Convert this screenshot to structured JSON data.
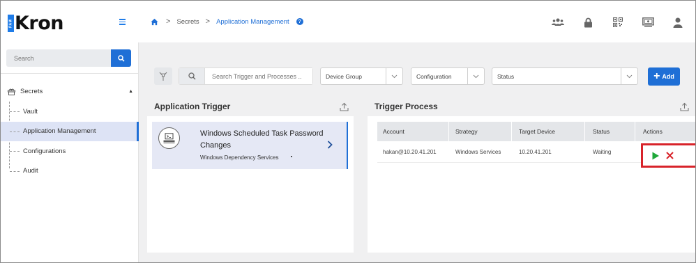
{
  "app": {
    "logo_badge": "PAM",
    "logo_text": "Kron"
  },
  "breadcrumb": {
    "items": [
      "Secrets",
      "Application Management"
    ],
    "separator": ">",
    "help": "?"
  },
  "top_icons": [
    "users-icon",
    "lock-icon",
    "qr-code-icon",
    "monitor-icon",
    "user-icon"
  ],
  "sidebar": {
    "search_placeholder": "Search",
    "group_label": "Secrets",
    "items": [
      {
        "label": "Vault",
        "active": false
      },
      {
        "label": "Application Management",
        "active": true
      },
      {
        "label": "Configurations",
        "active": false
      },
      {
        "label": "Audit",
        "active": false
      }
    ]
  },
  "filters": {
    "search_placeholder": "Search Trigger and Processes ..",
    "device_group": "Device Group",
    "configuration": "Configuration",
    "status": "Status",
    "add_label": "Add"
  },
  "application_trigger": {
    "title": "Application Trigger",
    "card": {
      "title": "Windows Scheduled Task Password Changes",
      "subtitle": "Windows Dependency Services"
    }
  },
  "trigger_process": {
    "title": "Trigger Process",
    "columns": [
      "Account",
      "Strategy",
      "Target Device",
      "Status",
      "Actions"
    ],
    "rows": [
      {
        "account": "hakan@10.20.41.201",
        "strategy": "Windows Services",
        "target_device": "10.20.41.201",
        "status": "Waiting"
      }
    ]
  },
  "colors": {
    "accent": "#1f6fd6",
    "play": "#1fa83a",
    "cancel": "#d8232a",
    "highlight_border": "#d8232a"
  }
}
